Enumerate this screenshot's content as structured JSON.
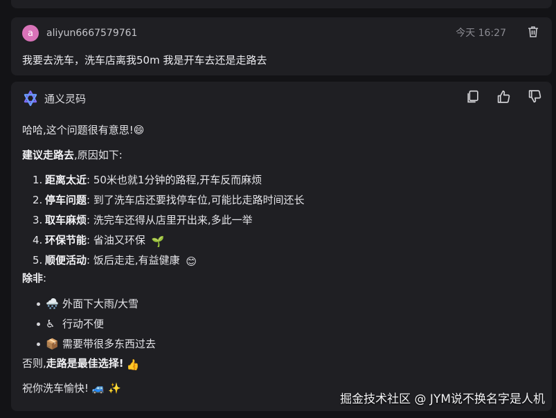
{
  "user_message": {
    "avatar_letter": "a",
    "avatar_color": "#d873b8",
    "username": "aliyun6667579761",
    "timestamp": "今天 16:27",
    "text": "我要去洗车，洗车店离我50m 我是开车去还是走路去"
  },
  "ai_message": {
    "name": "通义灵码",
    "intro": "哈哈,这个问题很有意思!😄",
    "suggestion_bold": "建议走路去",
    "suggestion_rest": ",原因如下:",
    "reasons": [
      {
        "num": "1.",
        "title": "距离太近",
        "text": ": 50米也就1分钟的路程,开车反而麻烦",
        "icon": ""
      },
      {
        "num": "2.",
        "title": "停车问题",
        "text": ": 到了洗车店还要找停车位,可能比走路时间还长",
        "icon": ""
      },
      {
        "num": "3.",
        "title": "取车麻烦",
        "text": ": 洗完车还得从店里开出来,多此一举",
        "icon": ""
      },
      {
        "num": "4.",
        "title": "环保节能",
        "text": ": 省油又环保 ",
        "icon": "🌱"
      },
      {
        "num": "5.",
        "title": "顺便活动",
        "text": ": 饭后走走,有益健康 ",
        "icon": "😊"
      }
    ],
    "unless_label": "除非",
    "unless_colon": ":",
    "exceptions": [
      {
        "icon": "🌨️",
        "text": "外面下大雨/大雪"
      },
      {
        "icon": "♿",
        "text": "行动不便"
      },
      {
        "icon": "📦",
        "text": "需要带很多东西过去"
      }
    ],
    "otherwise_prefix": "否则,",
    "otherwise_bold": "走路是最佳选择!",
    "otherwise_icon": "👍",
    "closing": "祝你洗车愉快! ",
    "closing_icons": "🚙 ✨"
  },
  "watermark": "掘金技术社区 @ JYM说不换名字是人机",
  "colors": {
    "page_bg": "#131316",
    "card_bg": "#1f1f23",
    "logo_purple": "#7b6cf6",
    "logo_blue": "#6b9bff"
  }
}
